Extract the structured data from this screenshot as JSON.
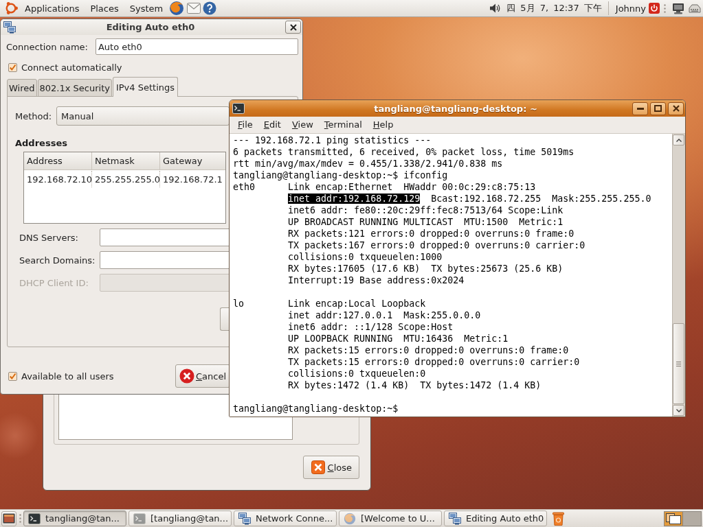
{
  "top_panel": {
    "menus": [
      {
        "label": "Applications"
      },
      {
        "label": "Places"
      },
      {
        "label": "System"
      }
    ],
    "clock": "四 5月 7, 12:37 下午",
    "user": "Johnny"
  },
  "dialog": {
    "title": "Editing Auto eth0",
    "connection_name": {
      "label": "Connection name:",
      "value": "Auto eth0"
    },
    "connect_automatically": {
      "label": "Connect automatically",
      "checked": true
    },
    "tabs": [
      {
        "label": "Wired",
        "selected": false
      },
      {
        "label": "802.1x Security",
        "selected": false
      },
      {
        "label": "IPv4 Settings",
        "selected": true
      }
    ],
    "method": {
      "label": "Method:",
      "value": "Manual"
    },
    "addresses": {
      "title": "Addresses",
      "columns": [
        "Address",
        "Netmask",
        "Gateway"
      ],
      "rows": [
        [
          "192.168.72.10",
          "255.255.255.0",
          "192.168.72.1"
        ]
      ]
    },
    "fields": [
      {
        "label": "DNS Servers:",
        "disabled": false
      },
      {
        "label": "Search Domains:",
        "disabled": false
      },
      {
        "label": "DHCP Client ID:",
        "disabled": true
      }
    ],
    "available_to_all_users": {
      "label": "Available to all users",
      "checked": true
    },
    "buttons": [
      {
        "kind": "cancel",
        "label": "Cancel"
      }
    ]
  },
  "terminal": {
    "title": "tangliang@tangliang-desktop: ~",
    "menus": [
      "File",
      "Edit",
      "View",
      "Terminal",
      "Help"
    ],
    "lines": [
      {
        "kind": "plain",
        "text": "--- 192.168.72.1 ping statistics ---"
      },
      {
        "kind": "plain",
        "text": "6 packets transmitted, 6 received, 0% packet loss, time 5019ms"
      },
      {
        "kind": "plain",
        "text": "rtt min/avg/max/mdev = 0.455/1.338/2.941/0.838 ms"
      },
      {
        "kind": "plain",
        "text": "tangliang@tangliang-desktop:~$ ifconfig"
      },
      {
        "kind": "field",
        "iface": "eth0",
        "text": "Link encap:Ethernet  HWaddr 00:0c:29:c8:75:13"
      },
      {
        "kind": "field",
        "segments": [
          {
            "text": "inet addr:192.168.72.129",
            "selected": true
          },
          {
            "text": "Bcast:192.168.72.255  Mask:255.255.255.0",
            "selected": false
          }
        ]
      },
      {
        "kind": "field",
        "text": "inet6 addr: fe80::20c:29ff:fec8:7513/64 Scope:Link"
      },
      {
        "kind": "field",
        "text": "UP BROADCAST RUNNING MULTICAST  MTU:1500  Metric:1"
      },
      {
        "kind": "field",
        "text": "RX packets:121 errors:0 dropped:0 overruns:0 frame:0"
      },
      {
        "kind": "field",
        "text": "TX packets:167 errors:0 dropped:0 overruns:0 carrier:0"
      },
      {
        "kind": "field",
        "text": "collisions:0 txqueuelen:1000"
      },
      {
        "kind": "field",
        "text": "RX bytes:17605 (17.6 KB)  TX bytes:25673 (25.6 KB)"
      },
      {
        "kind": "field",
        "text": "Interrupt:19 Base address:0x2024"
      },
      {
        "kind": "blank"
      },
      {
        "kind": "field",
        "iface": "lo",
        "text": "Link encap:Local Loopback"
      },
      {
        "kind": "field",
        "text": "inet addr:127.0.0.1  Mask:255.0.0.0"
      },
      {
        "kind": "field",
        "text": "inet6 addr: ::1/128 Scope:Host"
      },
      {
        "kind": "field",
        "text": "UP LOOPBACK RUNNING  MTU:16436  Metric:1"
      },
      {
        "kind": "field",
        "text": "RX packets:15 errors:0 dropped:0 overruns:0 frame:0"
      },
      {
        "kind": "field",
        "text": "TX packets:15 errors:0 dropped:0 overruns:0 carrier:0"
      },
      {
        "kind": "field",
        "text": "collisions:0 txqueuelen:0"
      },
      {
        "kind": "field",
        "text": "RX bytes:1472 (1.4 KB)  TX bytes:1472 (1.4 KB)"
      },
      {
        "kind": "blank"
      },
      {
        "kind": "plain",
        "text": "tangliang@tangliang-desktop:~$"
      }
    ]
  },
  "back_window": {
    "buttons": [
      {
        "kind": "close",
        "label": "Close"
      }
    ]
  },
  "taskbar": {
    "tasks": [
      {
        "kind": "terminal",
        "label": "tangliang@tan...",
        "selected": true,
        "minimized": false
      },
      {
        "kind": "terminal",
        "label": "[tangliang@tan...",
        "selected": false,
        "minimized": true
      },
      {
        "kind": "network",
        "label": "Network Conne...",
        "selected": false,
        "minimized": false
      },
      {
        "kind": "browser",
        "label": "[Welcome to U...",
        "selected": false,
        "minimized": true
      },
      {
        "kind": "network",
        "label": "Editing Auto eth0",
        "selected": false,
        "minimized": false
      }
    ],
    "workspaces": [
      {
        "selected": true
      },
      {
        "selected": false
      }
    ]
  }
}
